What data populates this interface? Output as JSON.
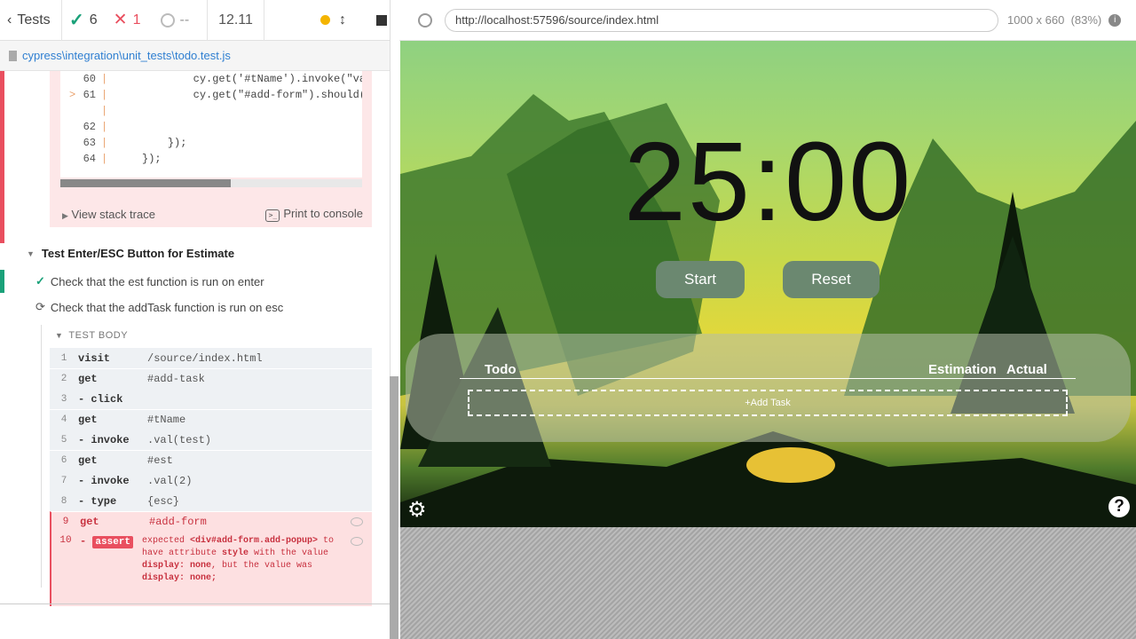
{
  "reporter": {
    "back_label": "Tests",
    "passed_count": "6",
    "failed_count": "1",
    "pending_count": "--",
    "duration": "12.11",
    "spec_path": "cypress\\integration\\unit_tests\\todo.test.js",
    "code_lines": [
      {
        "num": "60",
        "text": "            cy.get('#tName').invoke(\"val",
        "marker": ""
      },
      {
        "num": "61",
        "text": "            cy.get(\"#add-form\").should('",
        "marker": ">"
      },
      {
        "num": "",
        "text": "                                         ^",
        "marker": ""
      },
      {
        "num": "62",
        "text": "",
        "marker": ""
      },
      {
        "num": "63",
        "text": "        });",
        "marker": ""
      },
      {
        "num": "64",
        "text": "    });",
        "marker": ""
      }
    ],
    "view_stack_trace": "View stack trace",
    "print_to_console": "Print to console",
    "suite_title": "Test Enter/ESC Button for Estimate",
    "tests": [
      {
        "title": "Check that the est function is run on enter",
        "state": "passed"
      },
      {
        "title": "Check that the addTask function is run on esc",
        "state": "running"
      }
    ],
    "test_body_label": "TEST BODY",
    "commands": [
      {
        "num": "1",
        "name": "visit",
        "message": "/source/index.html"
      },
      {
        "num": "2",
        "name": "get",
        "message": "#add-task"
      },
      {
        "num": "3",
        "name": "- click",
        "message": ""
      },
      {
        "num": "4",
        "name": "get",
        "message": "#tName"
      },
      {
        "num": "5",
        "name": "- invoke",
        "message": ".val(test)"
      },
      {
        "num": "6",
        "name": "get",
        "message": "#est"
      },
      {
        "num": "7",
        "name": "- invoke",
        "message": ".val(2)"
      },
      {
        "num": "8",
        "name": "- type",
        "message": "{esc}"
      },
      {
        "num": "9",
        "name": "get",
        "message": "#add-form"
      }
    ],
    "assert": {
      "num": "10",
      "badge": "assert",
      "p1": "expected ",
      "el": "<div#add-form.add-popup>",
      "p2": " to have attribute ",
      "attr": "style",
      "p3": " with the value ",
      "val1": "display: none",
      "p4": ", but the value was ",
      "val2": "display: none;"
    }
  },
  "aut": {
    "url": "http://localhost:57596/source/index.html",
    "viewport": "1000 x 660",
    "scale": "(83%)"
  },
  "app": {
    "timer": "25:00",
    "start_label": "Start",
    "reset_label": "Reset",
    "col_todo": "Todo",
    "col_estimation": "Estimation",
    "col_actual": "Actual",
    "add_task_label": "+Add Task",
    "help_label": "?"
  },
  "colors": {
    "passed": "#1aa179",
    "failed": "#e94f5f",
    "button_bg": "#6b8870"
  }
}
